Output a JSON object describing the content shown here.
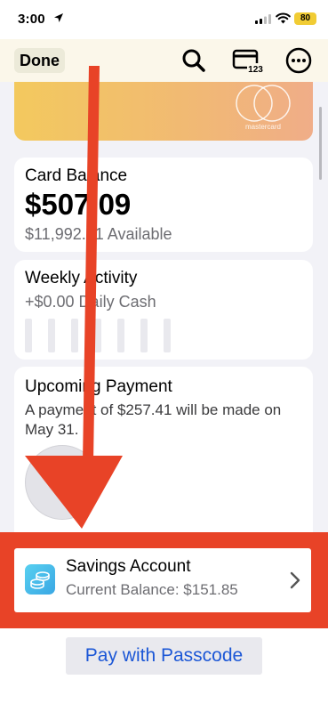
{
  "status_bar": {
    "time": "3:00",
    "battery_level": "80",
    "icons": [
      "location-arrow-icon",
      "cellular-signal-icon",
      "wifi-icon",
      "battery-icon"
    ],
    "battery_color": "#f1cc34"
  },
  "nav": {
    "done_label": "Done",
    "icons": [
      "search-icon",
      "card-number-icon",
      "more-options-icon"
    ],
    "card_number_icon_text": "123"
  },
  "card": {
    "network_text": "mastercard",
    "gradient_colors": [
      "#f3c95e",
      "#f0ad88"
    ]
  },
  "card_balance": {
    "title": "Card Balance",
    "amount": "$507.09",
    "available": "$11,992.91 Available"
  },
  "weekly_activity": {
    "title": "Weekly Activity",
    "daily_cash": "+$0.00 Daily Cash",
    "bar_count": 7
  },
  "upcoming_payment": {
    "title": "Upcoming Payment",
    "description": "A payment of $257.41 will be made on May 31."
  },
  "savings": {
    "title": "Savings Account",
    "balance": "Current Balance: $151.85",
    "icon": "savings-coins-icon",
    "highlight_color": "#e84327"
  },
  "bottom": {
    "pay_button_label": "Pay with Passcode",
    "accent_color": "#1c57d6"
  },
  "annotation": {
    "arrow_color": "#e84327"
  }
}
